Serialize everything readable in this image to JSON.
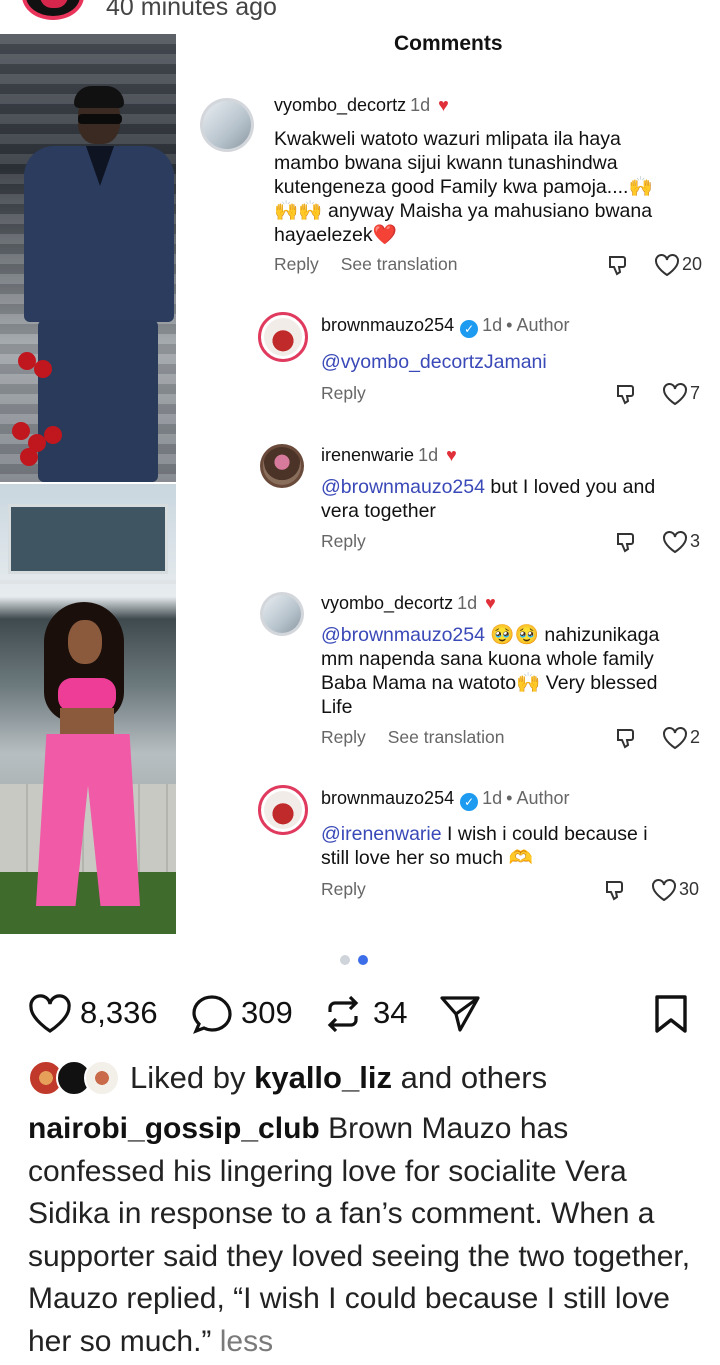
{
  "post": {
    "time_ago": "40 minutes ago",
    "comments_title": "Comments"
  },
  "comments": [
    {
      "username": "vyombo_decortz",
      "time": "1d",
      "author_label": "",
      "mention": "",
      "text_lines": [
        "Kwakweli watoto wazuri mlipata ila haya",
        "mambo bwana sijui kwann tunashindwa",
        "kutengeneza good Family kwa pamoja....🙌",
        "🙌🙌 anyway Maisha ya mahusiano bwana",
        "hayaelezek❤️"
      ],
      "reply_label": "Reply",
      "translate_label": "See translation",
      "likes": "20"
    },
    {
      "username": "brownmauzo254",
      "time": "1d",
      "author_label": "Author",
      "mention": "@vyombo_decortzJamani",
      "text_lines": [],
      "reply_label": "Reply",
      "translate_label": "",
      "likes": "7"
    },
    {
      "username": "irenenwarie",
      "time": "1d",
      "author_label": "",
      "mention": "@brownmauzo254",
      "text_lines": [
        " but I loved you and",
        "vera together"
      ],
      "reply_label": "Reply",
      "translate_label": "",
      "likes": "3"
    },
    {
      "username": "vyombo_decortz",
      "time": "1d",
      "author_label": "",
      "mention": "@brownmauzo254",
      "text_lines": [
        " 🥹🥹 nahizunikaga",
        "mm napenda sana kuona whole family",
        "Baba Mama na watoto🙌 Very blessed",
        "Life"
      ],
      "reply_label": "Reply",
      "translate_label": "See translation",
      "likes": "2"
    },
    {
      "username": "brownmauzo254",
      "time": "1d",
      "author_label": "Author",
      "mention": "@irenenwarie",
      "text_lines": [
        " I wish i could because i",
        "still love her so much 🫶"
      ],
      "reply_label": "Reply",
      "translate_label": "",
      "likes": "30"
    }
  ],
  "stats": {
    "likes": "8,336",
    "comments": "309",
    "reposts": "34"
  },
  "liked_by": {
    "prefix": "Liked by",
    "user": "kyallo_liz",
    "suffix": "and others"
  },
  "caption": {
    "username": "nairobi_gossip_club",
    "text": "Brown Mauzo has confessed his lingering love for socialite Vera Sidika in response to a fan’s comment. When a supporter said they loved seeing the two together, Mauzo replied, “I wish I could because I still love her so much.”",
    "more_label": "less"
  },
  "colors": {
    "mention": "#3a49b8",
    "verified": "#1d9bf0",
    "carousel_active": "#3b6ee8",
    "carousel_inactive": "#cfd3da"
  },
  "icons": [
    "heart-icon",
    "comment-icon",
    "repost-icon",
    "share-icon",
    "bookmark-icon",
    "dislike-icon",
    "verified-icon"
  ]
}
